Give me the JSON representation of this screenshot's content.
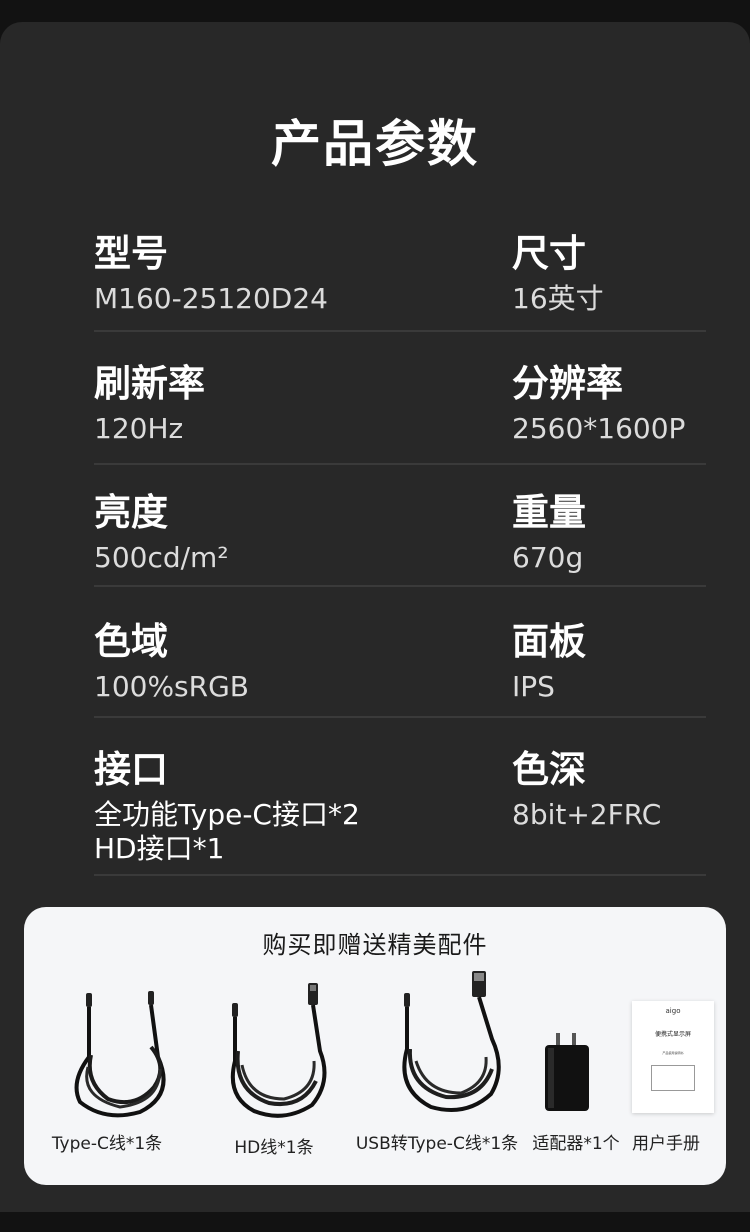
{
  "title": "产品参数",
  "specs": [
    {
      "left": {
        "label": "型号",
        "value": "M160-25120D24"
      },
      "right": {
        "label": "尺寸",
        "value": "16英寸"
      }
    },
    {
      "left": {
        "label": "刷新率",
        "value": "120Hz"
      },
      "right": {
        "label": "分辨率",
        "value": "2560*1600P"
      }
    },
    {
      "left": {
        "label": "亮度",
        "value": "500cd/m²"
      },
      "right": {
        "label": "重量",
        "value": "670g"
      }
    },
    {
      "left": {
        "label": "色域",
        "value": "100%sRGB"
      },
      "right": {
        "label": "面板",
        "value": "IPS"
      }
    },
    {
      "left": {
        "label": "接口",
        "value": "全功能Type-C接口*2",
        "value2": "HD接口*1"
      },
      "right": {
        "label": "色深",
        "value": "8bit+2FRC"
      }
    }
  ],
  "gifts": {
    "title": "购买即赠送精美配件",
    "items": [
      {
        "label": "Type-C线*1条",
        "icon": "type-c-cable-icon"
      },
      {
        "label": "HD线*1条",
        "icon": "hd-cable-icon"
      },
      {
        "label": "USB转Type-C线*1条",
        "icon": "usb-to-type-c-cable-icon"
      },
      {
        "label": "适配器*1个",
        "icon": "power-adapter-icon"
      },
      {
        "label": "用户手册",
        "icon": "user-manual-icon"
      }
    ],
    "manual": {
      "brand": "aigo",
      "heading": "便携式显示屏",
      "small": "产品使用说明书"
    }
  }
}
